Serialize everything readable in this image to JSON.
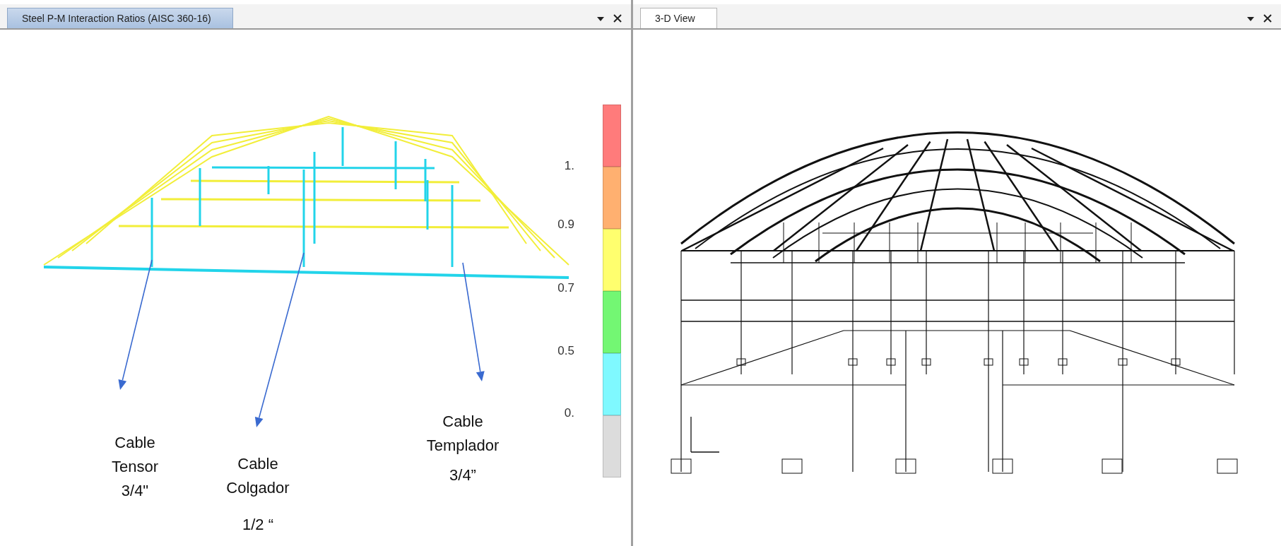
{
  "left_panel": {
    "tab": {
      "label": "Steel P-M Interaction Ratios  (AISC 360-16)",
      "selected": true
    },
    "legend": {
      "segments": [
        {
          "color": "#ff7b7b"
        },
        {
          "color": "#ffb070"
        },
        {
          "color": "#ffff6e"
        },
        {
          "color": "#73f773"
        },
        {
          "color": "#7ff9ff"
        },
        {
          "color": "#dcdcdc"
        }
      ],
      "labels": [
        "1.",
        "0.9",
        "0.7",
        "0.5",
        "0."
      ]
    },
    "annotations": [
      {
        "lines": [
          "Cable",
          "Tensor",
          "3/4\""
        ]
      },
      {
        "lines": [
          "Cable",
          "Colgador",
          "1/2 “"
        ]
      },
      {
        "lines": [
          "Cable",
          "Templador",
          "3/4”"
        ]
      }
    ]
  },
  "right_panel": {
    "tab": {
      "label": "3-D View",
      "selected": false
    }
  }
}
